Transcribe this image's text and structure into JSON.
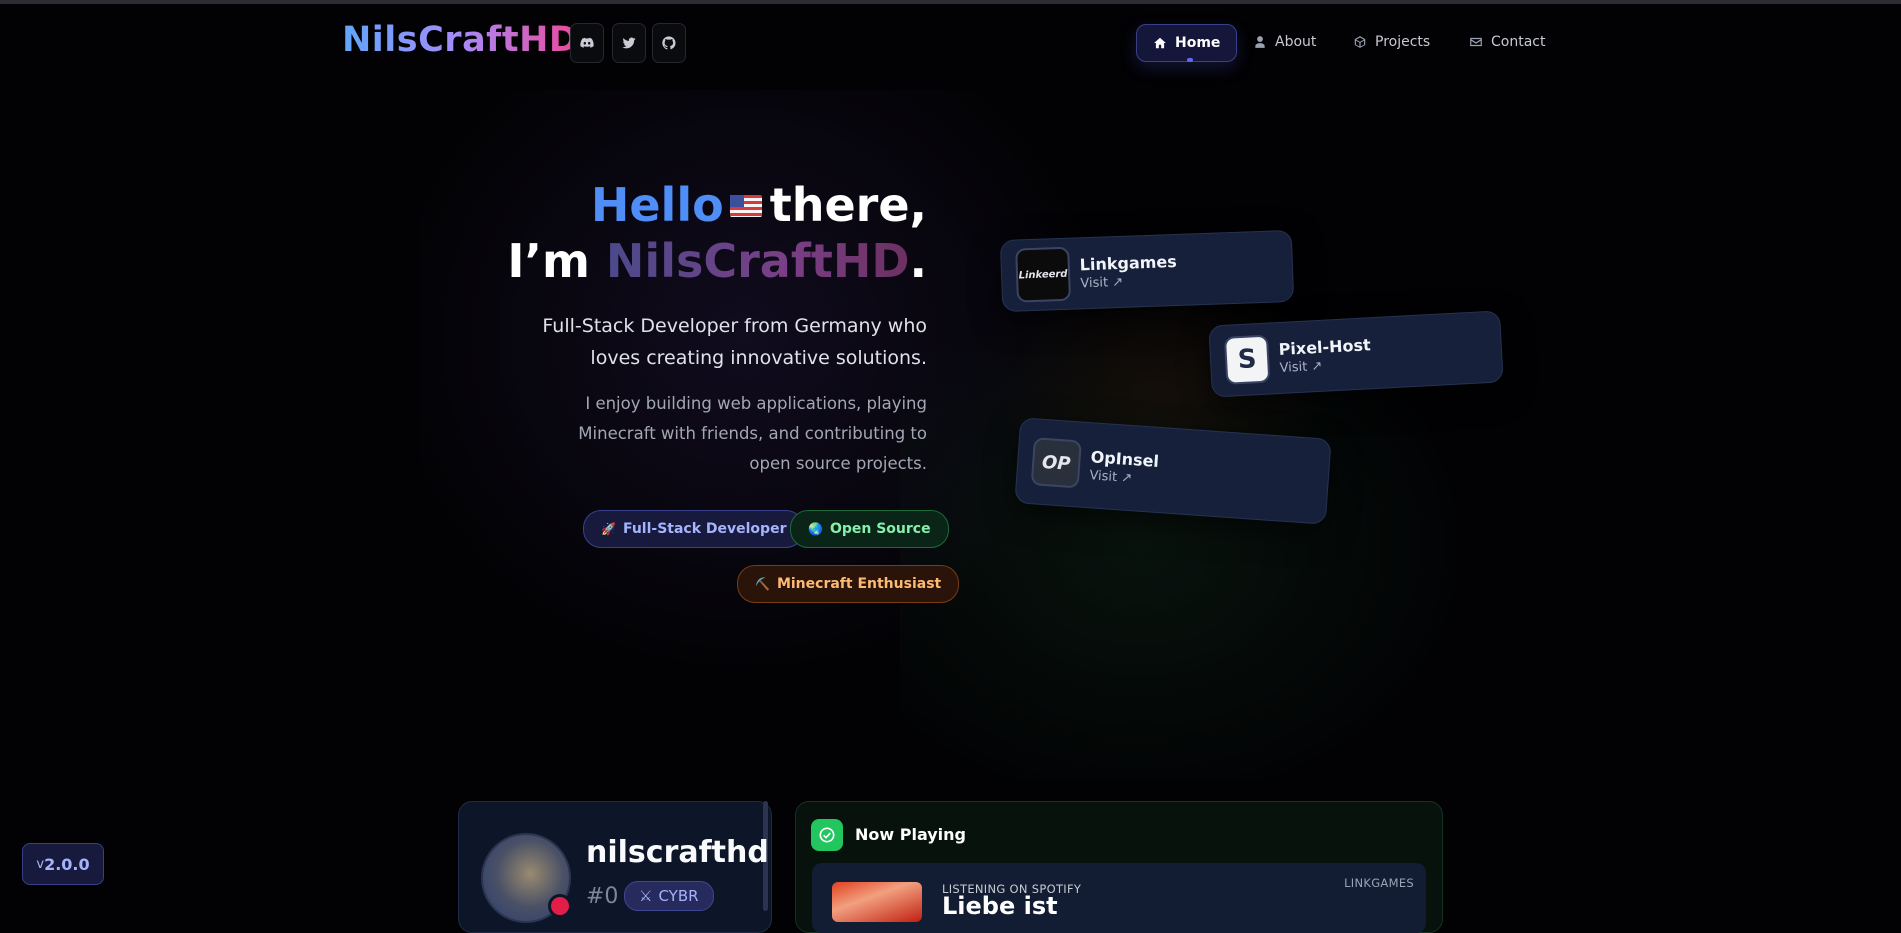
{
  "header": {
    "logo": "NilsCraftHD",
    "social": [
      {
        "icon": "discord-icon"
      },
      {
        "icon": "twitter-icon"
      },
      {
        "icon": "github-icon"
      }
    ],
    "nav": [
      {
        "label": "Home",
        "icon": "home-icon",
        "active": true
      },
      {
        "label": "About",
        "icon": "user-icon"
      },
      {
        "label": "Projects",
        "icon": "cube-icon"
      },
      {
        "label": "Contact",
        "icon": "envelope-icon"
      }
    ]
  },
  "hero": {
    "hello": "Hello",
    "there": "there,",
    "im": "I’m",
    "name": "NilsCraftHD",
    "period": ".",
    "subtitle_line1": "Full-Stack Developer from Germany who",
    "subtitle_line2": "loves creating innovative solutions.",
    "desc_line1": "I enjoy building web applications, playing",
    "desc_line2": "Minecraft with friends, and contributing to",
    "desc_line3": "open source projects.",
    "tags": [
      {
        "icon": "🚀",
        "label": "Full-Stack Developer"
      },
      {
        "icon": "🌏",
        "label": "Open Source"
      },
      {
        "icon": "⛏️",
        "label": "Minecraft Enthusiast"
      }
    ]
  },
  "partners": [
    {
      "name": "Linkgames",
      "visit": "Visit",
      "logo_text": "Linkeerd"
    },
    {
      "name": "Pixel-Host",
      "visit": "Visit",
      "logo_text": "S"
    },
    {
      "name": "OpInsel",
      "visit": "Visit",
      "logo_text": "OP"
    }
  ],
  "discord": {
    "username": "nilscrafthd",
    "tag": "#0",
    "badge": "CYBR"
  },
  "spotify": {
    "title": "Now Playing",
    "listening": "LISTENING ON SPOTIFY",
    "song": "Liebe ist",
    "artist": "LINKGAMES"
  },
  "version": {
    "prefix": "v",
    "number": "2.0.0"
  },
  "colors": {
    "accent": "#6366f1",
    "hello": "#4f8df7",
    "spotify_green": "#22c55e"
  }
}
